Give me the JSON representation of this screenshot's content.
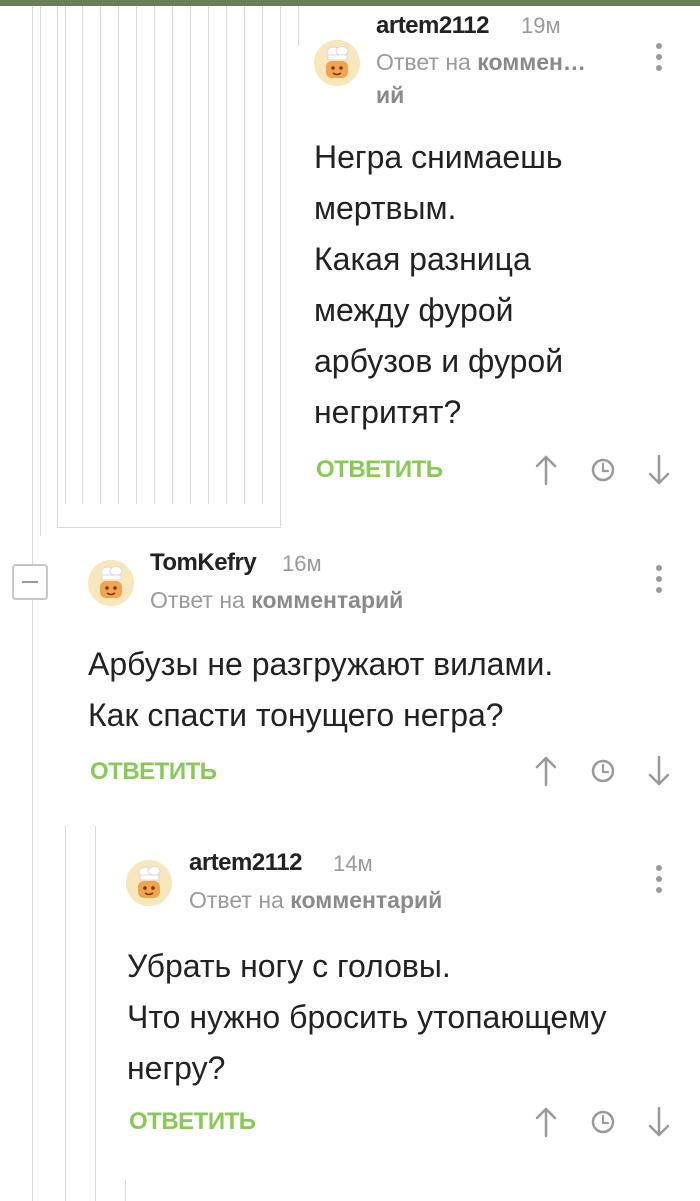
{
  "comments": [
    {
      "author": "artem2112",
      "time": "19м",
      "reply_prefix": "Ответ на",
      "reply_link_line1": "коммен…",
      "reply_link_line2": "ий",
      "body": "Негра снимаешь\nмертвым.\nКакая разница\nмежду фурой\nарбузов и фурой\nнегритят?",
      "reply_label": "ОТВЕТИТЬ"
    },
    {
      "author": "TomKefry",
      "time": "16м",
      "reply_prefix": "Ответ на",
      "reply_link": "комментарий",
      "body": "Арбузы не разгружают вилами.\nКак спасти тонущего негра?",
      "reply_label": "ОТВЕТИТЬ"
    },
    {
      "author": "artem2112",
      "time": "14м",
      "reply_prefix": "Ответ на",
      "reply_link": "комментарий",
      "body": "Убрать ногу с головы.\nЧто нужно бросить утопающему\nнегру?",
      "reply_label": "ОТВЕТИТЬ"
    }
  ],
  "icons": {
    "avatar": "chef-avatar-icon",
    "menu": "more-vertical-icon",
    "upvote": "arrow-up-icon",
    "history": "clock-icon",
    "downvote": "arrow-down-icon",
    "collapse": "minus-icon"
  },
  "colors": {
    "accent_green": "#8ac858",
    "muted_text": "#9a9a9a",
    "thread_line": "#d9d9d9",
    "top_bar": "#6b7f56"
  }
}
